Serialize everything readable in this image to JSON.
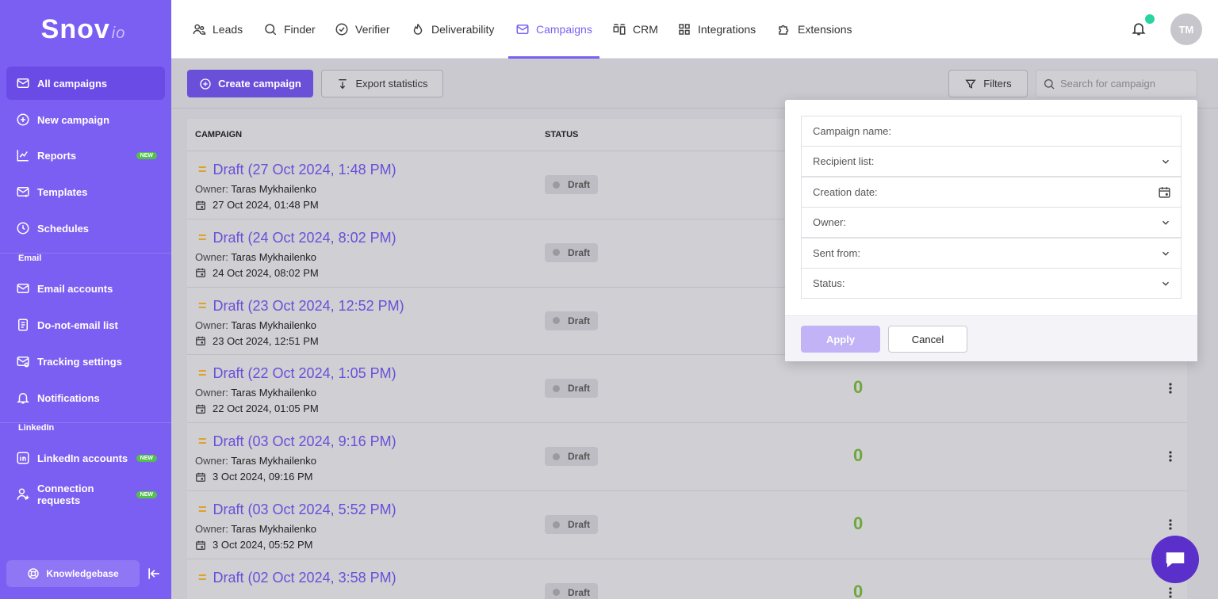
{
  "brand": {
    "logo_main": "Snov",
    "logo_suffix": "io"
  },
  "sidebar": {
    "items": [
      {
        "label": "All campaigns",
        "icon": "mail-icon",
        "active": true
      },
      {
        "label": "New campaign",
        "icon": "plus-circle-icon"
      },
      {
        "label": "Reports",
        "icon": "chart-icon",
        "badge": "NEW"
      },
      {
        "label": "Templates",
        "icon": "template-mail-icon"
      },
      {
        "label": "Schedules",
        "icon": "clock-icon"
      }
    ],
    "section_email": "Email",
    "email_items": [
      {
        "label": "Email accounts",
        "icon": "mail-icon"
      },
      {
        "label": "Do-not-email list",
        "icon": "list-doc-icon"
      },
      {
        "label": "Tracking settings",
        "icon": "tracking-mail-icon"
      },
      {
        "label": "Notifications",
        "icon": "bell-icon"
      }
    ],
    "section_linkedin": "LinkedIn",
    "linkedin_items": [
      {
        "label": "LinkedIn accounts",
        "icon": "linkedin-icon",
        "badge": "NEW"
      },
      {
        "label": "Connection requests",
        "icon": "user-plus-icon",
        "badge": "NEW"
      }
    ],
    "knowledgebase": "Knowledgebase"
  },
  "topnav": {
    "items": [
      {
        "label": "Leads",
        "icon": "users-icon"
      },
      {
        "label": "Finder",
        "icon": "search-icon"
      },
      {
        "label": "Verifier",
        "icon": "check-circle-icon"
      },
      {
        "label": "Deliverability",
        "icon": "flame-icon"
      },
      {
        "label": "Campaigns",
        "icon": "mail-icon",
        "active": true
      },
      {
        "label": "CRM",
        "icon": "kanban-icon"
      },
      {
        "label": "Integrations",
        "icon": "grid-icon"
      },
      {
        "label": "Extensions",
        "icon": "puzzle-icon"
      }
    ],
    "avatar_initials": "TM"
  },
  "toolbar": {
    "create_label": "Create campaign",
    "export_label": "Export statistics",
    "filters_label": "Filters",
    "search_placeholder": "Search for campaign"
  },
  "table": {
    "headers": {
      "campaign": "CAMPAIGN",
      "status": "STATUS"
    },
    "owner_prefix": "Owner:",
    "rows": [
      {
        "title": "Draft (27 Oct 2024, 1:48 PM)",
        "owner": "Taras Mykhailenko",
        "date": "27 Oct 2024, 01:48 PM",
        "status": "Draft",
        "count": ""
      },
      {
        "title": "Draft (24 Oct 2024, 8:02 PM)",
        "owner": "Taras Mykhailenko",
        "date": "24 Oct 2024, 08:02 PM",
        "status": "Draft",
        "count": ""
      },
      {
        "title": "Draft (23 Oct 2024, 12:52 PM)",
        "owner": "Taras Mykhailenko",
        "date": "23 Oct 2024, 12:51 PM",
        "status": "Draft",
        "count": ""
      },
      {
        "title": "Draft (22 Oct 2024, 1:05 PM)",
        "owner": "Taras Mykhailenko",
        "date": "22 Oct 2024, 01:05 PM",
        "status": "Draft",
        "count": "0"
      },
      {
        "title": "Draft (03 Oct 2024, 9:16 PM)",
        "owner": "Taras Mykhailenko",
        "date": "3 Oct 2024, 09:16 PM",
        "status": "Draft",
        "count": "0"
      },
      {
        "title": "Draft (03 Oct 2024, 5:52 PM)",
        "owner": "Taras Mykhailenko",
        "date": "3 Oct 2024, 05:52 PM",
        "status": "Draft",
        "count": "0"
      },
      {
        "title": "Draft (02 Oct 2024, 3:58 PM)",
        "owner": "",
        "date": "",
        "status": "Draft",
        "count": "0"
      }
    ]
  },
  "filters_panel": {
    "fields": [
      {
        "label": "Campaign name:",
        "control": "text"
      },
      {
        "label": "Recipient list:",
        "control": "select"
      },
      {
        "label": "Creation date:",
        "control": "date"
      },
      {
        "label": "Owner:",
        "control": "select"
      },
      {
        "label": "Sent from:",
        "control": "select"
      },
      {
        "label": "Status:",
        "control": "select"
      }
    ],
    "apply_label": "Apply",
    "cancel_label": "Cancel"
  },
  "colors": {
    "brand": "#7b5ff2",
    "primary_button": "#6a4fd8",
    "badge_new": "#54c04c",
    "notification_dot": "#2ad3a3",
    "count_green": "#6ea83a",
    "title_marker": "#e0a12a"
  }
}
